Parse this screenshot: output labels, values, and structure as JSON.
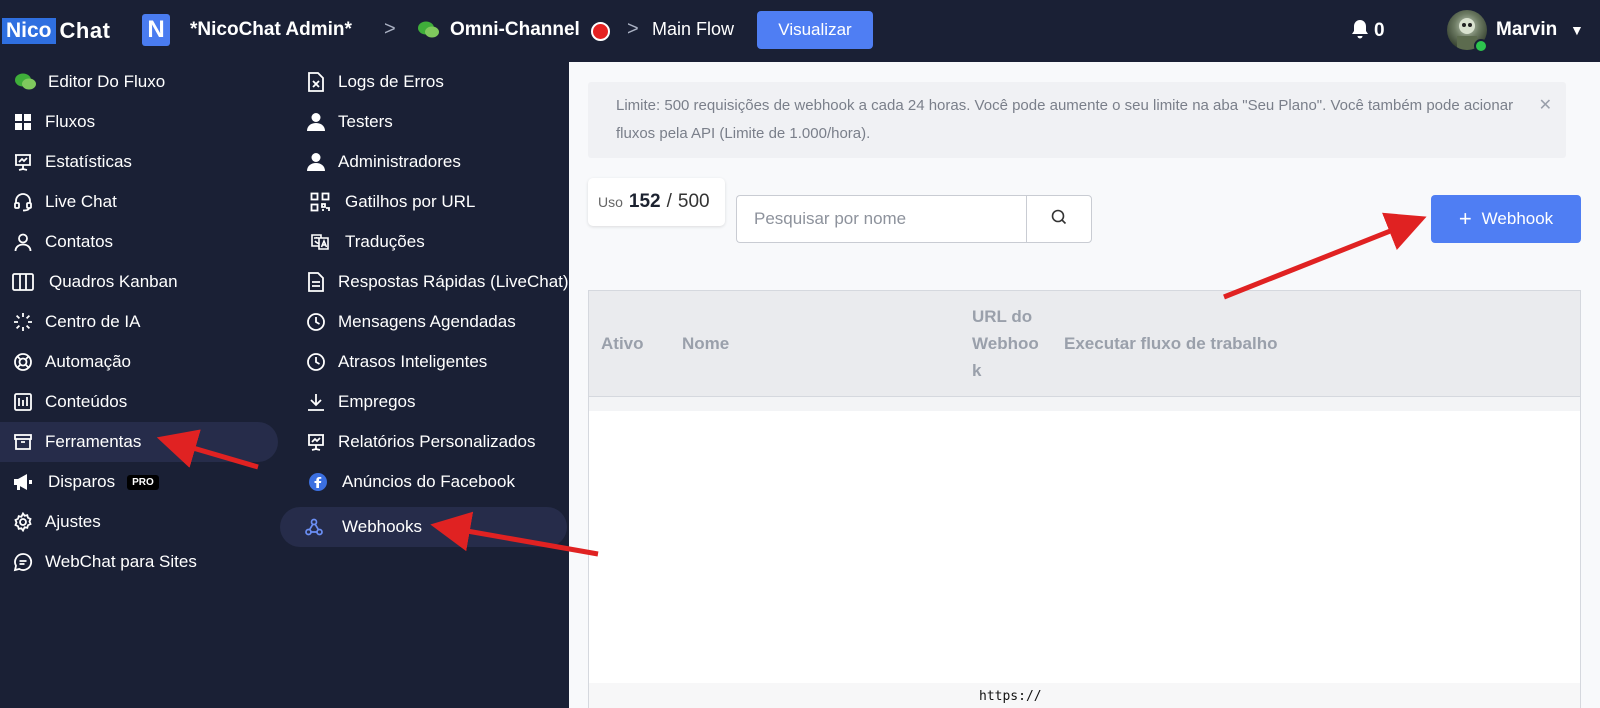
{
  "header": {
    "logo_part1": "Nico",
    "logo_part2": "Chat",
    "workspace_badge": "N",
    "workspace_name": "*NicoChat Admin*",
    "sep1": ">",
    "channel_name": "Omni-Channel",
    "sep2": ">",
    "flow_name": "Main Flow",
    "visualize_label": "Visualizar",
    "notifications_count": "0",
    "user_name": "Marvin"
  },
  "sidebar_left": [
    {
      "label": "Editor Do Fluxo",
      "icon": "chat-bubbles-icon"
    },
    {
      "label": "Fluxos",
      "icon": "grid-icon"
    },
    {
      "label": "Estatísticas",
      "icon": "presentation-chart-icon"
    },
    {
      "label": "Live Chat",
      "icon": "headset-icon"
    },
    {
      "label": "Contatos",
      "icon": "user-icon"
    },
    {
      "label": "Quadros Kanban",
      "icon": "columns-icon"
    },
    {
      "label": "Centro de IA",
      "icon": "sparkle-icon"
    },
    {
      "label": "Automação",
      "icon": "lifebuoy-icon"
    },
    {
      "label": "Conteúdos",
      "icon": "content-icon"
    },
    {
      "label": "Ferramentas",
      "icon": "archive-icon",
      "active": true
    },
    {
      "label": "Disparos",
      "icon": "megaphone-icon",
      "badge": "PRO"
    },
    {
      "label": "Ajustes",
      "icon": "gear-icon"
    },
    {
      "label": "WebChat para Sites",
      "icon": "message-circle-icon"
    }
  ],
  "sidebar_right": [
    {
      "label": "Logs de Erros",
      "icon": "error-file-icon"
    },
    {
      "label": "Testers",
      "icon": "user-solid-icon"
    },
    {
      "label": "Administradores",
      "icon": "user-solid-icon"
    },
    {
      "label": "Gatilhos por URL",
      "icon": "qr-code-icon"
    },
    {
      "label": "Traduções",
      "icon": "translate-icon"
    },
    {
      "label": "Respostas Rápidas (LiveChat)",
      "icon": "document-icon"
    },
    {
      "label": "Mensagens Agendadas",
      "icon": "clock-icon"
    },
    {
      "label": "Atrasos Inteligentes",
      "icon": "clock-icon"
    },
    {
      "label": "Empregos",
      "icon": "download-icon"
    },
    {
      "label": "Relatórios Personalizados",
      "icon": "presentation-chart-icon"
    },
    {
      "label": "Anúncios do Facebook",
      "icon": "facebook-icon"
    },
    {
      "label": "Webhooks",
      "icon": "webhook-icon",
      "active": true
    }
  ],
  "main": {
    "alert_text": "Limite: 500 requisições de webhook a cada 24 horas. Você pode aumente o seu limite na aba \"Seu Plano\". Você também pode acionar fluxos pela API (Limite de 1.000/hora).",
    "usage_label": "Uso",
    "usage_current": "152",
    "usage_sep": "/",
    "usage_max": "500",
    "search_placeholder": "Pesquisar por nome",
    "add_button_label": "Webhook",
    "table_headers": [
      "Ativo",
      "Nome",
      "URL do\nWebhoo\nk",
      "Executar fluxo de trabalho"
    ],
    "partial_cell": "https://"
  },
  "colors": {
    "background": "#1a2035",
    "primary": "#4f7ef3",
    "arrow": "#e02222"
  }
}
